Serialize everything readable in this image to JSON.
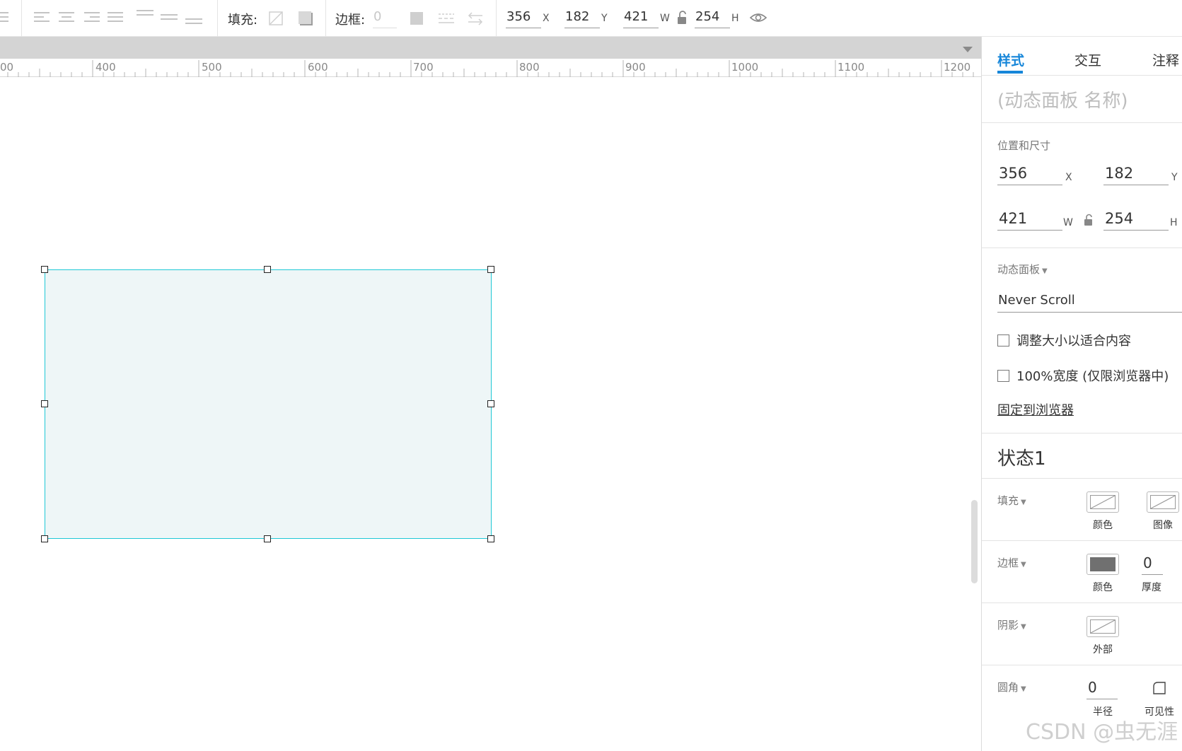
{
  "toolbar": {
    "fill_label": "填充:",
    "border_label": "边框:",
    "border_value": "0",
    "x_value": "356",
    "x_unit": "X",
    "y_value": "182",
    "y_unit": "Y",
    "w_value": "421",
    "w_unit": "W",
    "h_value": "254",
    "h_unit": "H",
    "icons": [
      "align-left-icon",
      "align-center-icon",
      "align-right-icon",
      "justify-icon",
      "align-top-icon",
      "align-middle-icon",
      "align-bottom-icon",
      "fill-color-icon",
      "shadow-icon",
      "border-color-icon",
      "border-style-icon",
      "arrow-style-icon",
      "lock-open-icon",
      "eye-icon"
    ]
  },
  "ruler": {
    "labels": [
      "00",
      "400",
      "500",
      "600",
      "700",
      "800",
      "900",
      "1000",
      "1100",
      "1200"
    ]
  },
  "canvas": {
    "selection_color": "#1fc8d6",
    "panel_fill": "#eef6f7"
  },
  "right_panel": {
    "tabs": [
      "样式",
      "交互",
      "注释"
    ],
    "active_tab": "样式",
    "widget_name_placeholder": "(动态面板 名称)",
    "position_size_title": "位置和尺寸",
    "x_value": "356",
    "x_unit": "X",
    "y_value": "182",
    "y_unit": "Y",
    "w_value": "421",
    "w_unit": "W",
    "h_value": "254",
    "h_unit": "H",
    "dynamic_panel_title": "动态面板",
    "scroll_option": "Never Scroll",
    "fit_content_label": "调整大小以适合内容",
    "full_width_label": "100%宽度 (仅限浏览器中)",
    "pin_to_browser_link": "固定到浏览器",
    "state_title": "状态1",
    "fill_section": "填充",
    "fill_color_label": "颜色",
    "fill_image_label": "图像",
    "border_section": "边框",
    "border_color_label": "颜色",
    "border_thickness_value": "0",
    "border_thickness_label": "厚度",
    "shadow_section": "阴影",
    "shadow_outer_label": "外部",
    "corner_section": "圆角",
    "corner_radius_value": "0",
    "corner_radius_label": "半径",
    "corner_visibility_label": "可见性",
    "accent_color": "#1686d9",
    "border_swatch_color": "#707070"
  },
  "watermark": "CSDN @虫无涯"
}
